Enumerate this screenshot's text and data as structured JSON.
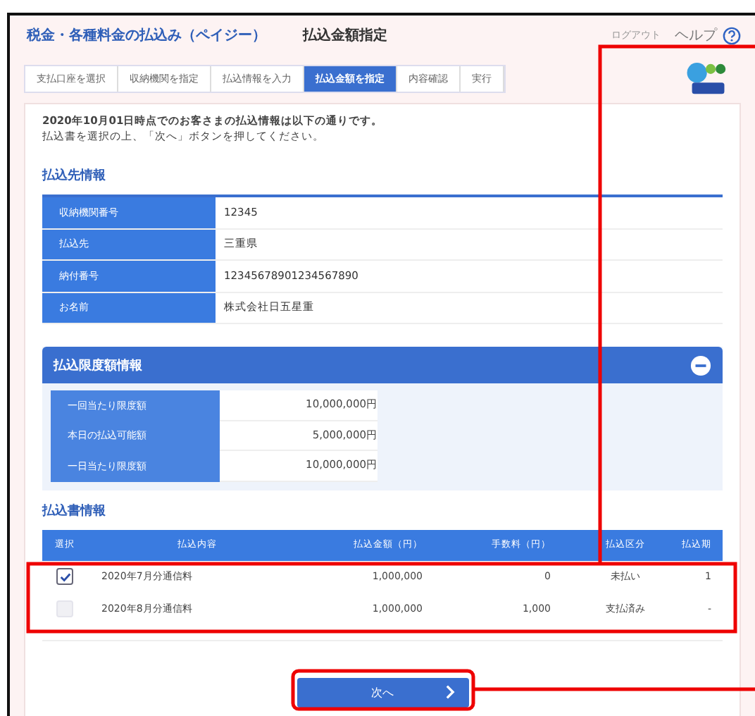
{
  "header": {
    "title": "税金・各種料金の払込み（ペイジー）",
    "page": "払込金額指定",
    "logout": "ログアウト",
    "help": "ヘルプ"
  },
  "steps": [
    {
      "label": "支払口座を選択",
      "selected": false
    },
    {
      "label": "収納機関を指定",
      "selected": false
    },
    {
      "label": "払込情報を入力",
      "selected": false
    },
    {
      "label": "払込金額を指定",
      "selected": true
    },
    {
      "label": "内容確認",
      "selected": false
    },
    {
      "label": "実行",
      "selected": false
    }
  ],
  "message": [
    "2020年10月01日時点でのお客さまの払込情報は以下の通りです。",
    "払込書を選択の上、「次へ」ボタンを押してください。"
  ],
  "payee": {
    "title": "払込先情報",
    "rows": [
      {
        "label": "収納機関番号",
        "value": "12345"
      },
      {
        "label": "払込先",
        "value": "三重県"
      },
      {
        "label": "納付番号",
        "value": "12345678901234567890"
      },
      {
        "label": "お名前",
        "value": "株式会社日五星重"
      }
    ]
  },
  "limits": {
    "title": "払込限度額情報",
    "expanded": true,
    "rows": [
      {
        "label": "一回当たり限度額",
        "value": "10,000,000円"
      },
      {
        "label": "本日の払込可能額",
        "value": "5,000,000円"
      },
      {
        "label": "一日当たり限度額",
        "value": "10,000,000円"
      }
    ]
  },
  "bills": {
    "title": "払込書情報",
    "columns": [
      "選択",
      "払込内容",
      "払込金額（円）",
      "手数料（円）",
      "払込区分",
      "払込期"
    ],
    "rows": [
      {
        "checked": true,
        "disabled": false,
        "content": "2020年7月分通信料",
        "amount": "1,000,000",
        "fee": "0",
        "status": "未払い",
        "period": "1"
      },
      {
        "checked": false,
        "disabled": true,
        "content": "2020年8月分通信料",
        "amount": "1,000,000",
        "fee": "1,000",
        "status": "支払済み",
        "period": "-"
      }
    ]
  },
  "next_button": "次へ"
}
